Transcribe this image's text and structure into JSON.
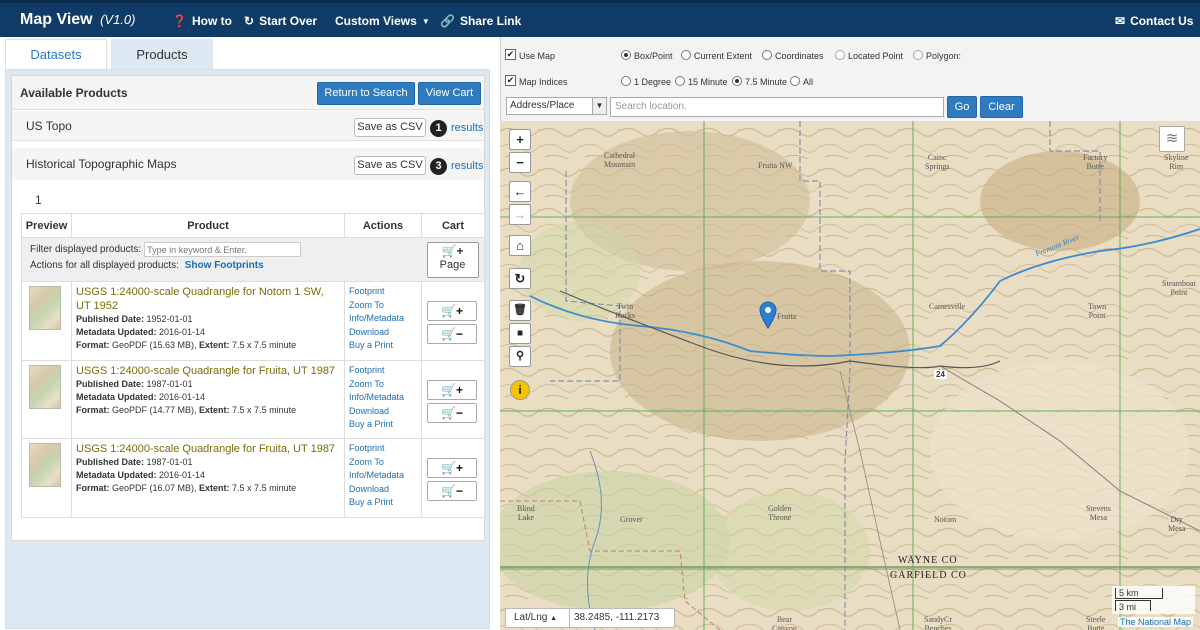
{
  "app": {
    "title": "Map View",
    "version": "(V1.0)",
    "nav": {
      "how_to": "How to",
      "start_over": "Start Over",
      "custom_views": "Custom Views",
      "share_link": "Share Link",
      "contact_us": "Contact Us"
    }
  },
  "tabs": [
    "Datasets",
    "Products"
  ],
  "products_panel": {
    "title": "Available Products",
    "return_button": "Return to Search",
    "view_cart_button": "View Cart",
    "sections": [
      {
        "name": "US Topo",
        "save_label": "Save as CSV",
        "count": "1",
        "results_label": "results"
      },
      {
        "name": "Historical Topographic Maps",
        "save_label": "Save as CSV",
        "count": "3",
        "results_label": "results"
      }
    ],
    "page_number": "1",
    "table": {
      "headers": [
        "Preview",
        "Product",
        "Actions",
        "Cart"
      ],
      "filter_label": "Filter displayed products:",
      "filter_placeholder": "Type in keyword & Enter.",
      "actions_label": "Actions for all displayed products:",
      "show_footprints": "Show Footprints",
      "page_button": "Page",
      "rows": [
        {
          "title": "USGS 1:24000-scale Quadrangle for Notom 1 SW, UT 1952",
          "published_label": "Published Date:",
          "published": "1952-01-01",
          "metadata_label": "Metadata Updated:",
          "metadata": "2016-01-14",
          "format_label": "Format:",
          "format": "GeoPDF (15.63 MB),",
          "extent_label": "Extent:",
          "extent": "7.5 x 7.5 minute"
        },
        {
          "title": "USGS 1:24000-scale Quadrangle for Fruita, UT 1987",
          "published_label": "Published Date:",
          "published": "1987-01-01",
          "metadata_label": "Metadata Updated:",
          "metadata": "2016-01-14",
          "format_label": "Format:",
          "format": "GeoPDF (14.77 MB),",
          "extent_label": "Extent:",
          "extent": "7.5 x 7.5 minute"
        },
        {
          "title": "USGS 1:24000-scale Quadrangle for Fruita, UT 1987",
          "published_label": "Published Date:",
          "published": "1987-01-01",
          "metadata_label": "Metadata Updated:",
          "metadata": "2016-01-14",
          "format_label": "Format:",
          "format": "GeoPDF (16.07 MB),",
          "extent_label": "Extent:",
          "extent": "7.5 x 7.5 minute"
        }
      ],
      "actions": [
        "Footprint",
        "Zoom To",
        "Info/Metadata",
        "Download",
        "Buy a Print"
      ]
    }
  },
  "map_controls": {
    "use_map": "Use Map",
    "map_indices": "Map Indices",
    "query_modes": [
      "Box/Point",
      "Current Extent",
      "Coordinates",
      "Located Point",
      "Polygon:"
    ],
    "scales": [
      "1 Degree",
      "15 Minute",
      "7.5 Minute",
      "All"
    ],
    "location_type": "Address/Place",
    "search_placeholder": "Search location.",
    "go": "Go",
    "clear": "Clear"
  },
  "map": {
    "coord_label": "Lat/Lng",
    "coords": "38.2485, -111.2173",
    "attribution": "The National Map",
    "scale_km": "5 km",
    "scale_mi": "3 mi",
    "county_upper": "WAYNE CO",
    "county_lower": "GARFIELD CO",
    "river": "Fremont River",
    "highway": "24",
    "places": {
      "cathedral_mountain": "Cathedral\nMountain",
      "fruita_nw": "Fruita NW",
      "cainc_springs": "Cainc\nSprings",
      "factory_butte": "Factory\nButte",
      "skyline_rim": "Skyline\nRim",
      "twin_rocks": "Twin\nRocks",
      "fruita": "Fruita",
      "cainesville": "Cainesville",
      "town_point": "Town\nPoint",
      "steamboat_point": "Steamboat\nPoint",
      "blind_lake": "Blind\nLake",
      "grover": "Grover",
      "golden_throne": "Golden\nThrone",
      "notom": "Notom",
      "stevens_mesa": "Stevens\nMesa",
      "dry_mesa": "Dry\nMesa",
      "bear_canyon": "Bear\nCanyon",
      "sandy_benches": "SandyCr\nBenches",
      "steele_butte": "Steele\nButte"
    }
  },
  "colors": {
    "topbar": "#0f3b66",
    "accent": "#2f7bbf",
    "panel": "#dce9f2",
    "marker": "#2a7fd4"
  }
}
